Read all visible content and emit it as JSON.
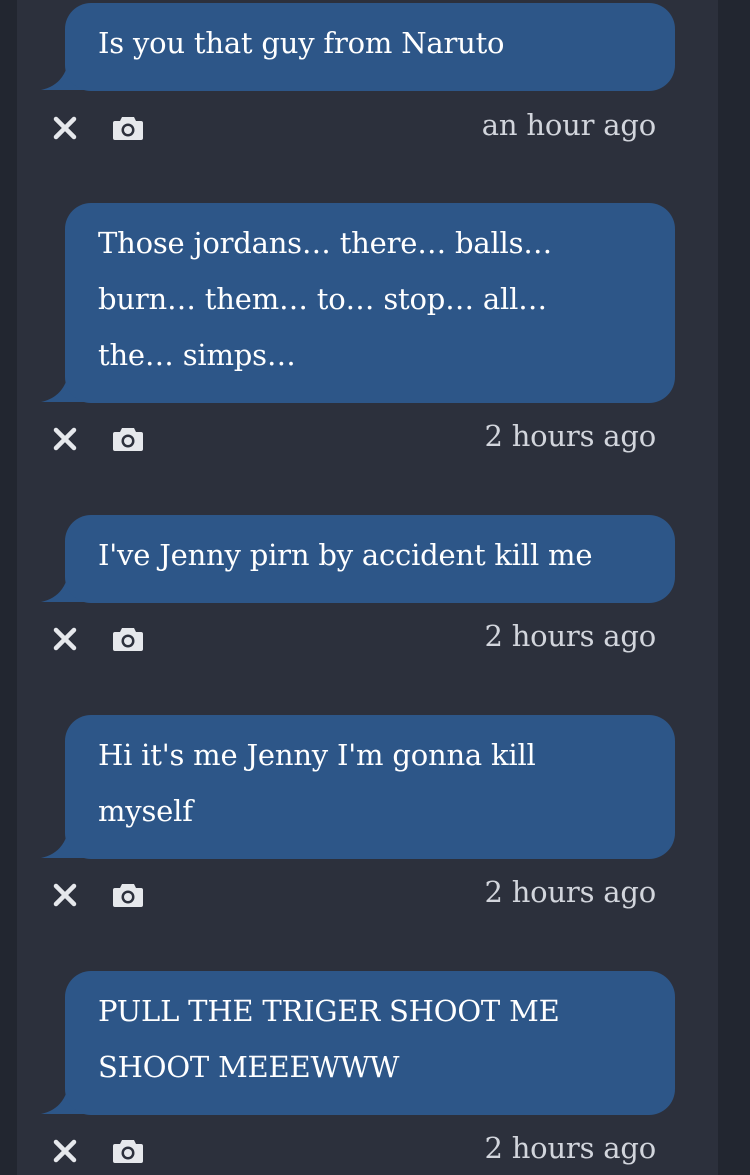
{
  "messages": [
    {
      "text": "Is you that guy from Naruto",
      "time": "an hour ago"
    },
    {
      "text": "Those jordans… there… balls… burn… them… to… stop… all… the… simps…",
      "time": "2 hours ago"
    },
    {
      "text": "I've Jenny pirn by accident kill me",
      "time": "2 hours ago"
    },
    {
      "text": "Hi it's me Jenny I'm gonna kill myself",
      "time": "2 hours ago"
    },
    {
      "text": "PULL THE TRIGER SHOOT ME SHOOT MEEEWWW",
      "time": "2 hours ago"
    }
  ],
  "icons": {
    "dismiss": "close-icon",
    "screenshot": "camera-icon"
  },
  "colors": {
    "background": "#2a2e39",
    "bubble": "#2d5688",
    "text": "#ffffff",
    "muted": "#d2d5dc"
  }
}
